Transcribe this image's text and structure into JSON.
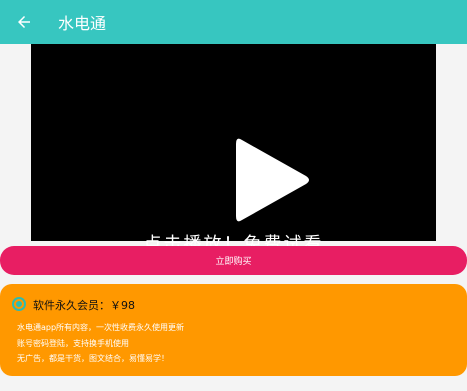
{
  "appbar": {
    "back_icon": "arrow-left-icon",
    "title": "水电通",
    "color": "#37c6c0"
  },
  "video": {
    "play_icon": "play-icon",
    "caption": "点击播放！免费试看"
  },
  "buy_button": {
    "label": "立即购买",
    "color": "#e81e63"
  },
  "plan": {
    "selected": true,
    "title": "软件永久会员：￥98",
    "color": "#ff9800",
    "description_lines": [
      "水电通app所有内容，一次性收费永久使用更新",
      "账号密码登陆，支持换手机使用",
      "无广告，都是干货，图文结合，易懂易学！"
    ]
  }
}
